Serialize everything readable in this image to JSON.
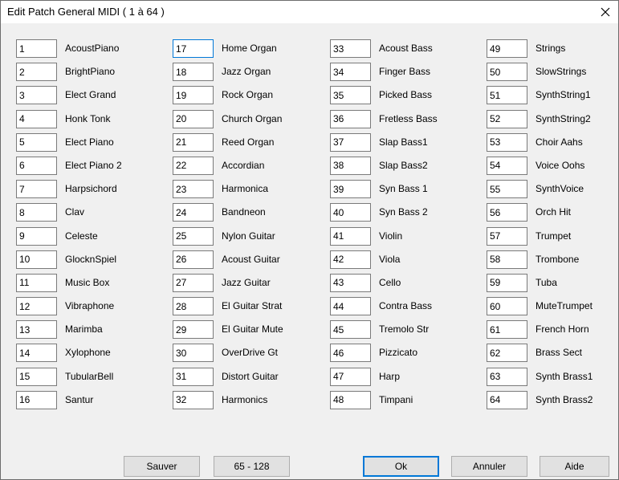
{
  "dialog": {
    "title": "Edit Patch General MIDI ( 1 à 64 )"
  },
  "columns": [
    {
      "patches": [
        {
          "number": "1",
          "name": "AcoustPiano"
        },
        {
          "number": "2",
          "name": "BrightPiano"
        },
        {
          "number": "3",
          "name": "Elect Grand"
        },
        {
          "number": "4",
          "name": "Honk Tonk"
        },
        {
          "number": "5",
          "name": "Elect Piano"
        },
        {
          "number": "6",
          "name": "Elect Piano 2"
        },
        {
          "number": "7",
          "name": "Harpsichord"
        },
        {
          "number": "8",
          "name": "Clav"
        },
        {
          "number": "9",
          "name": "Celeste"
        },
        {
          "number": "10",
          "name": "GlocknSpiel"
        },
        {
          "number": "11",
          "name": "Music Box"
        },
        {
          "number": "12",
          "name": "Vibraphone"
        },
        {
          "number": "13",
          "name": "Marimba"
        },
        {
          "number": "14",
          "name": "Xylophone"
        },
        {
          "number": "15",
          "name": "TubularBell"
        },
        {
          "number": "16",
          "name": "Santur"
        }
      ]
    },
    {
      "patches": [
        {
          "number": "17",
          "name": "Home Organ"
        },
        {
          "number": "18",
          "name": "Jazz Organ"
        },
        {
          "number": "19",
          "name": "Rock Organ"
        },
        {
          "number": "20",
          "name": "Church Organ"
        },
        {
          "number": "21",
          "name": "Reed Organ"
        },
        {
          "number": "22",
          "name": "Accordian"
        },
        {
          "number": "23",
          "name": "Harmonica"
        },
        {
          "number": "24",
          "name": "Bandneon"
        },
        {
          "number": "25",
          "name": "Nylon Guitar"
        },
        {
          "number": "26",
          "name": "Acoust Guitar"
        },
        {
          "number": "27",
          "name": "Jazz Guitar"
        },
        {
          "number": "28",
          "name": "El Guitar Strat"
        },
        {
          "number": "29",
          "name": "El Guitar Mute"
        },
        {
          "number": "30",
          "name": "OverDrive Gt"
        },
        {
          "number": "31",
          "name": "Distort Guitar"
        },
        {
          "number": "32",
          "name": "Harmonics"
        }
      ]
    },
    {
      "patches": [
        {
          "number": "33",
          "name": "Acoust Bass"
        },
        {
          "number": "34",
          "name": "Finger Bass"
        },
        {
          "number": "35",
          "name": "Picked Bass"
        },
        {
          "number": "36",
          "name": "Fretless Bass"
        },
        {
          "number": "37",
          "name": "Slap Bass1"
        },
        {
          "number": "38",
          "name": "Slap Bass2"
        },
        {
          "number": "39",
          "name": "Syn Bass 1"
        },
        {
          "number": "40",
          "name": "Syn Bass 2"
        },
        {
          "number": "41",
          "name": "Violin"
        },
        {
          "number": "42",
          "name": "Viola"
        },
        {
          "number": "43",
          "name": "Cello"
        },
        {
          "number": "44",
          "name": "Contra Bass"
        },
        {
          "number": "45",
          "name": "Tremolo Str"
        },
        {
          "number": "46",
          "name": "Pizzicato"
        },
        {
          "number": "47",
          "name": "Harp"
        },
        {
          "number": "48",
          "name": "Timpani"
        }
      ]
    },
    {
      "patches": [
        {
          "number": "49",
          "name": "Strings"
        },
        {
          "number": "50",
          "name": "SlowStrings"
        },
        {
          "number": "51",
          "name": "SynthString1"
        },
        {
          "number": "52",
          "name": "SynthString2"
        },
        {
          "number": "53",
          "name": "Choir Aahs"
        },
        {
          "number": "54",
          "name": "Voice Oohs"
        },
        {
          "number": "55",
          "name": "SynthVoice"
        },
        {
          "number": "56",
          "name": "Orch Hit"
        },
        {
          "number": "57",
          "name": "Trumpet"
        },
        {
          "number": "58",
          "name": "Trombone"
        },
        {
          "number": "59",
          "name": "Tuba"
        },
        {
          "number": "60",
          "name": "MuteTrumpet"
        },
        {
          "number": "61",
          "name": "French Horn"
        },
        {
          "number": "62",
          "name": "Brass Sect"
        },
        {
          "number": "63",
          "name": "Synth Brass1"
        },
        {
          "number": "64",
          "name": "Synth Brass2"
        }
      ]
    }
  ],
  "buttons": {
    "save": "Sauver",
    "next_range": "65 - 128",
    "ok": "Ok",
    "cancel": "Annuler",
    "help": "Aide"
  },
  "icons": {
    "close": "close-icon"
  },
  "colors": {
    "focus_border": "#0078d7",
    "dialog_bg": "#f0f0f0",
    "button_bg": "#e1e1e1"
  }
}
